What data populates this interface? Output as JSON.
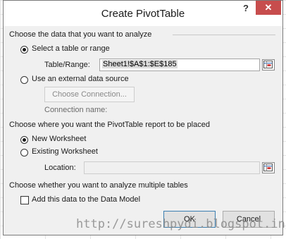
{
  "dialog": {
    "title": "Create PivotTable",
    "help_label": "?",
    "close_label": "✕"
  },
  "section1": {
    "heading": "Choose the data that you want to analyze",
    "radio_table_label": "Select a table or range",
    "table_range_label": "Table/Range:",
    "table_range_value": "Sheet1!$A$1:$E$185",
    "radio_external_label": "Use an external data source",
    "choose_connection_label": "Choose Connection...",
    "connection_name_label": "Connection name:"
  },
  "section2": {
    "heading": "Choose where you want the PivotTable report to be placed",
    "radio_new_label": "New Worksheet",
    "radio_existing_label": "Existing Worksheet",
    "location_label": "Location:"
  },
  "section3": {
    "heading": "Choose whether you want to analyze multiple tables",
    "checkbox_label": "Add this data to the Data Model"
  },
  "buttons": {
    "ok_label": "OK",
    "cancel_label": "Cancel"
  },
  "watermark": "http://sureshpydi.blogspot.in/"
}
